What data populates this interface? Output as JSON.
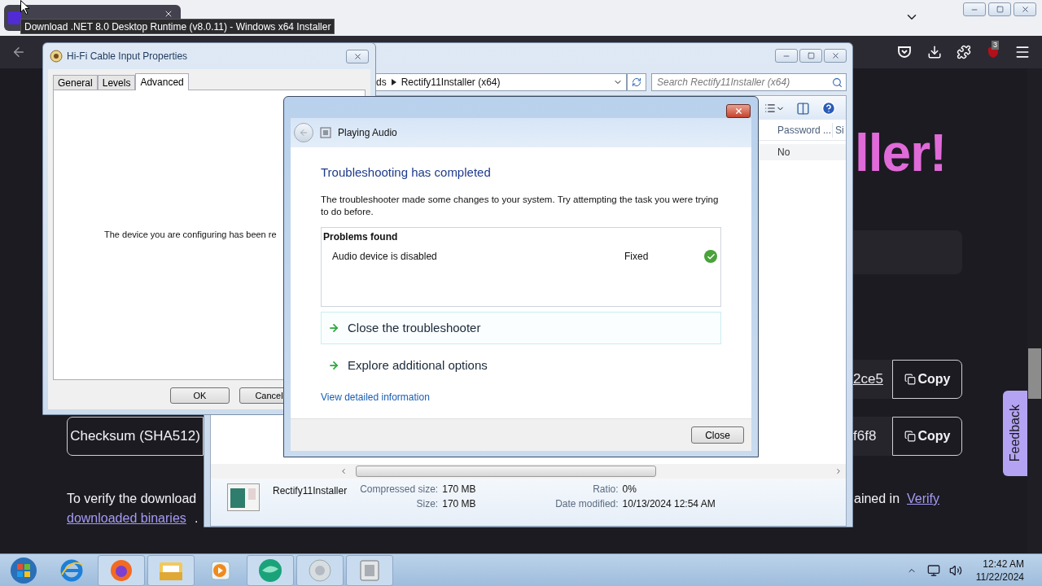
{
  "browser": {
    "tab_tooltip": "Download .NET 8.0 Desktop Runtime (v8.0.11) - Windows x64 Installer",
    "extension_badge": "3",
    "page": {
      "heading": "ller!",
      "hash_rows": [
        {
          "value": "2ce5",
          "copy": "Copy"
        },
        {
          "label": "Checksum (SHA512)",
          "value": "f6f8",
          "copy": "Copy"
        }
      ],
      "note_start": "To verify the download",
      "note_end": "ained in",
      "note_link_start": "Verify",
      "note_link_end": "downloaded binaries",
      "note_tail": ".",
      "feedback": "Feedback"
    }
  },
  "explorer": {
    "breadcrumb": [
      "ds",
      "Rectify11Installer (x64)"
    ],
    "search_placeholder": "Search Rectify11Installer (x64)",
    "columns": [
      "Password ...",
      "Si"
    ],
    "rows": [
      [
        "No"
      ]
    ],
    "details": {
      "name": "Rectify11Installer",
      "fields": [
        {
          "label": "Compressed size:",
          "value": "170 MB"
        },
        {
          "label": "Ratio:",
          "value": "0%"
        },
        {
          "label": "Size:",
          "value": "170 MB"
        },
        {
          "label": "Date modified:",
          "value": "10/13/2024 12:54 AM"
        }
      ]
    }
  },
  "properties": {
    "title": "Hi-Fi Cable Input Properties",
    "tabs": [
      {
        "label": "General",
        "selected": false
      },
      {
        "label": "Levels",
        "selected": false
      },
      {
        "label": "Advanced",
        "selected": true
      }
    ],
    "message": "The device you are configuring has been re",
    "buttons": [
      "OK",
      "Cancel"
    ]
  },
  "troubleshooter": {
    "title": "Playing Audio",
    "heading": "Troubleshooting has completed",
    "description": "The troubleshooter made some changes to your system. Try attempting the task you were trying to do before.",
    "problems_header": "Problems found",
    "problems": [
      {
        "name": "Audio device is disabled",
        "status": "Fixed",
        "fixed": true
      }
    ],
    "options": [
      {
        "label": "Close the troubleshooter",
        "selected": true
      },
      {
        "label": "Explore additional options",
        "selected": false
      }
    ],
    "details_link": "View detailed information",
    "close_button": "Close"
  },
  "taskbar": {
    "time": "12:42 AM",
    "date": "11/22/2024"
  }
}
